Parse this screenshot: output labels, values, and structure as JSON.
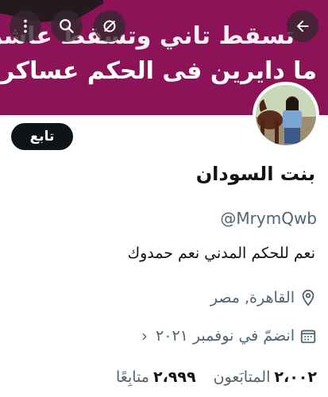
{
  "header": {
    "banner_line1": "تسقط تاني وتسقط عاشر",
    "banner_line2": "ما دايرين فى الحكم عساكر",
    "banner_color": "#8c1357"
  },
  "toolbar": {
    "back_icon": "arrow-left-icon",
    "mute_icon": "bell-off-icon",
    "search_icon": "search-icon",
    "more_icon": "more-vertical-icon"
  },
  "profile": {
    "follow_label": "تابع",
    "name": "بنت السودان",
    "handle": "@MrymQwb",
    "bio": "نعم للحكم المدني نعم حمدوك",
    "location": "القاهرة, مصر",
    "joined": "انضمّ في نوفمبر ٢٠٢١",
    "followers_count": "٢،٠٠٢",
    "followers_label": "المتابَعون",
    "following_count": "٢،٩٩٩",
    "following_label": "متابِعًا"
  }
}
